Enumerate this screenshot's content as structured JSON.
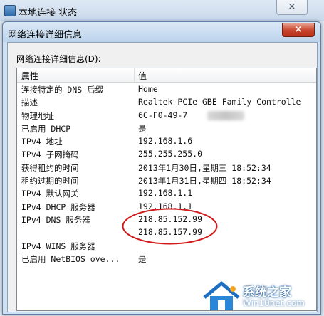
{
  "background_window": {
    "title": "本地连接 状态",
    "close_glyph": "×"
  },
  "dialog": {
    "title": "网络连接详细信息",
    "close_glyph": "×",
    "list_label": "网络连接详细信息(D):",
    "columns": {
      "property": "属性",
      "value": "值"
    },
    "rows": [
      {
        "k": "连接特定的 DNS 后缀",
        "v": "Home"
      },
      {
        "k": "描述",
        "v": "Realtek PCIe GBE Family Controlle"
      },
      {
        "k": "物理地址",
        "v": "6C-F0-49-7"
      },
      {
        "k": "已启用 DHCP",
        "v": "是"
      },
      {
        "k": "IPv4 地址",
        "v": "192.168.1.6"
      },
      {
        "k": "IPv4 子网掩码",
        "v": "255.255.255.0"
      },
      {
        "k": "获得租约的时间",
        "v": "2013年1月30日,星期三 18:52:34"
      },
      {
        "k": "租约过期的时间",
        "v": "2013年1月31日,星期四 18:52:34"
      },
      {
        "k": "IPv4 默认网关",
        "v": "192.168.1.1"
      },
      {
        "k": "IPv4 DHCP 服务器",
        "v": "192.168.1.1"
      },
      {
        "k": "IPv4 DNS 服务器",
        "v": "218.85.152.99"
      },
      {
        "k": "",
        "v": "218.85.157.99"
      },
      {
        "k": "IPv4 WINS 服务器",
        "v": ""
      },
      {
        "k": "已启用 NetBIOS ove...",
        "v": "是"
      }
    ]
  },
  "watermark": {
    "name": "系统之家",
    "url": "Win10net.com"
  },
  "colors": {
    "annotation": "#d21a1a",
    "close_button": "#c7432b"
  }
}
